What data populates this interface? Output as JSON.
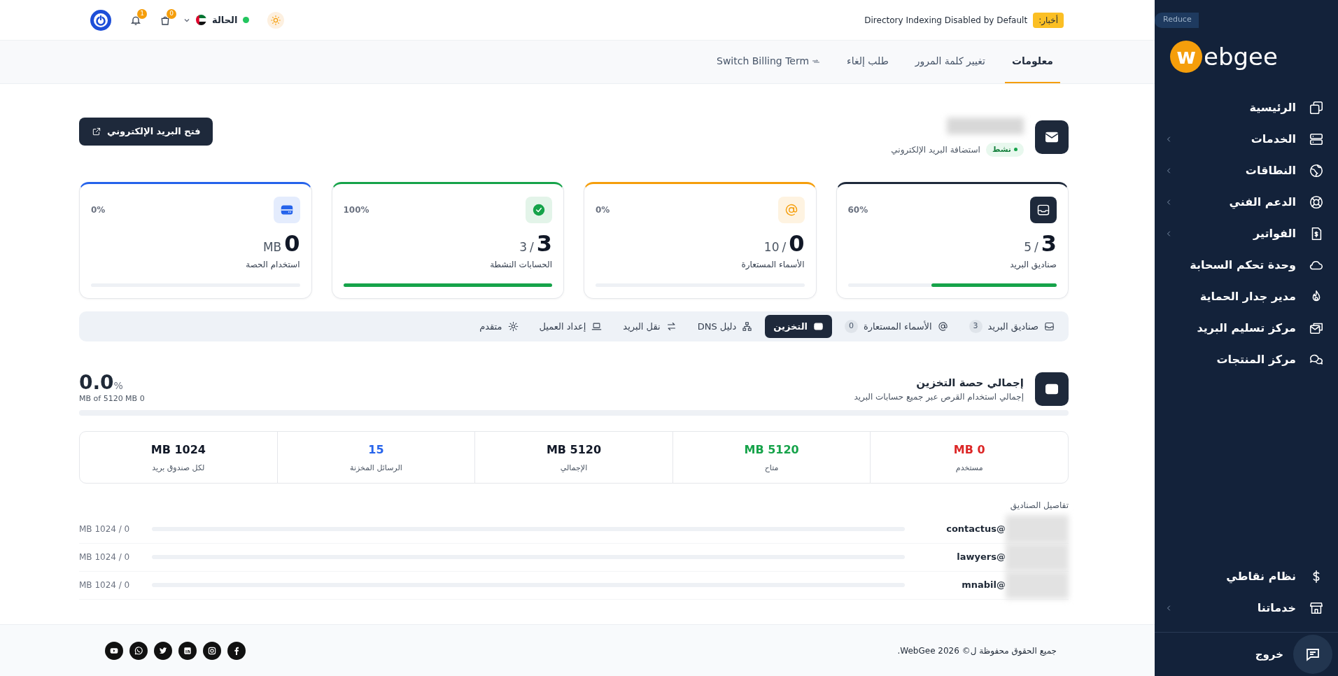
{
  "topbar": {
    "news_badge": "أخبار:",
    "news_text": "Directory Indexing Disabled by Default",
    "status_label": "الحالة",
    "status_online": true,
    "cart_count": "0",
    "notifications_count": "1"
  },
  "subnav": {
    "tabs": [
      {
        "label": "معلومات",
        "selected": true
      },
      {
        "label": "تغيير كلمة المرور",
        "selected": false
      },
      {
        "label": "طلب إلغاء",
        "selected": false
      },
      {
        "label": "Switch Billing Term",
        "selected": false,
        "kind": "switch"
      }
    ]
  },
  "header": {
    "status_badge": "نشط",
    "product": "استضافة البريد الإلكتروني",
    "open_button": "فتح البريد الإلكتروني"
  },
  "stat_cards": [
    {
      "kind": "mailboxes",
      "label": "صناديق البريد",
      "value": "3",
      "separator": "/",
      "total": "5",
      "percent": "60%",
      "level": 0.6,
      "color": "#1e293b"
    },
    {
      "kind": "aliases",
      "label": "الأسماء المستعارة",
      "value": "0",
      "separator": "/",
      "total": "10",
      "percent": "0%",
      "level": 0,
      "color": "#f59e0b"
    },
    {
      "kind": "accounts",
      "label": "الحسابات النشطة",
      "value": "3",
      "separator": "/",
      "total": "3",
      "percent": "100%",
      "level": 1,
      "color": "#16a34a"
    },
    {
      "kind": "quota",
      "label": "استخدام الحصة",
      "value": "0",
      "total": "MB",
      "percent": "0%",
      "level": 0,
      "color": "#2563eb"
    }
  ],
  "tabs": [
    {
      "kind": "inbox",
      "label": "صناديق البريد",
      "count": "3",
      "selected": false
    },
    {
      "kind": "at",
      "label": "الأسماء المستعارة",
      "count": "0",
      "selected": false
    },
    {
      "kind": "storage",
      "label": "التخزين",
      "selected": true
    },
    {
      "kind": "network",
      "label": "دليل DNS",
      "selected": false
    },
    {
      "kind": "transfer",
      "label": "نقل البريد",
      "selected": false
    },
    {
      "kind": "laptop",
      "label": "إعداد العميل",
      "selected": false
    },
    {
      "kind": "gear",
      "label": "متقدم",
      "selected": false
    }
  ],
  "storage": {
    "title": "إجمالي حصة التخزين",
    "subtitle": "إجمالي استخدام القرص عبر جميع حسابات البريد",
    "percent": "0.0",
    "percent_sign": "%",
    "usage": "MB of 5120 MB 0",
    "level": 0
  },
  "stats": [
    {
      "value": "MB 0",
      "label": "مستخدم",
      "color": "#dc2626"
    },
    {
      "value": "MB 5120",
      "label": "متاح",
      "color": "#16a34a"
    },
    {
      "value": "MB 5120",
      "label": "الإجمالي",
      "color": "#111827"
    },
    {
      "value": "15",
      "label": "الرسائل المخزنة",
      "color": "#2563eb"
    },
    {
      "value": "MB 1024",
      "label": "لكل صندوق بريد",
      "color": "#111827"
    }
  ],
  "mailbox_details": {
    "title": "تفاصيل الصناديق",
    "rows": [
      {
        "address": "contactus@",
        "usage": "MB 1024 / 0",
        "level": 0
      },
      {
        "address": "lawyers@",
        "usage": "MB 1024 / 0",
        "level": 0
      },
      {
        "address": "mnabil@",
        "usage": "MB 1024 / 0",
        "level": 0
      }
    ]
  },
  "footer": {
    "copyright": "جميع الحقوق محفوظة ل© WebGee 2026.",
    "social": [
      {
        "kind": "facebook"
      },
      {
        "kind": "instagram"
      },
      {
        "kind": "linkedin"
      },
      {
        "kind": "twitter"
      },
      {
        "kind": "whatsapp"
      },
      {
        "kind": "youtube"
      }
    ]
  },
  "sidebar": {
    "reduce_button": "Reduce",
    "logo_mark": "w",
    "logo_text": "ebgee",
    "items": [
      {
        "kind": "home",
        "label": "الرئيسية",
        "submenu": false
      },
      {
        "kind": "services",
        "label": "الخدمات",
        "submenu": true
      },
      {
        "kind": "domains",
        "label": "النطاقات",
        "submenu": true
      },
      {
        "kind": "support",
        "label": "الدعم الفني",
        "submenu": true
      },
      {
        "kind": "invoices",
        "label": "الفواتير",
        "submenu": true
      },
      {
        "kind": "cloud",
        "label": "وحدة تحكم السحابة",
        "submenu": false
      },
      {
        "kind": "firewall",
        "label": "مدير جدار الحماية",
        "submenu": false
      },
      {
        "kind": "mail",
        "label": "مركز تسليم البريد",
        "submenu": false
      },
      {
        "kind": "products",
        "label": "مركز المنتجات",
        "submenu": false
      }
    ],
    "bottom_items": [
      {
        "kind": "points",
        "label": "نظام نقاطي",
        "submenu": false
      },
      {
        "kind": "store",
        "label": "خدماتنا",
        "submenu": true
      }
    ],
    "logout": "خروج"
  }
}
